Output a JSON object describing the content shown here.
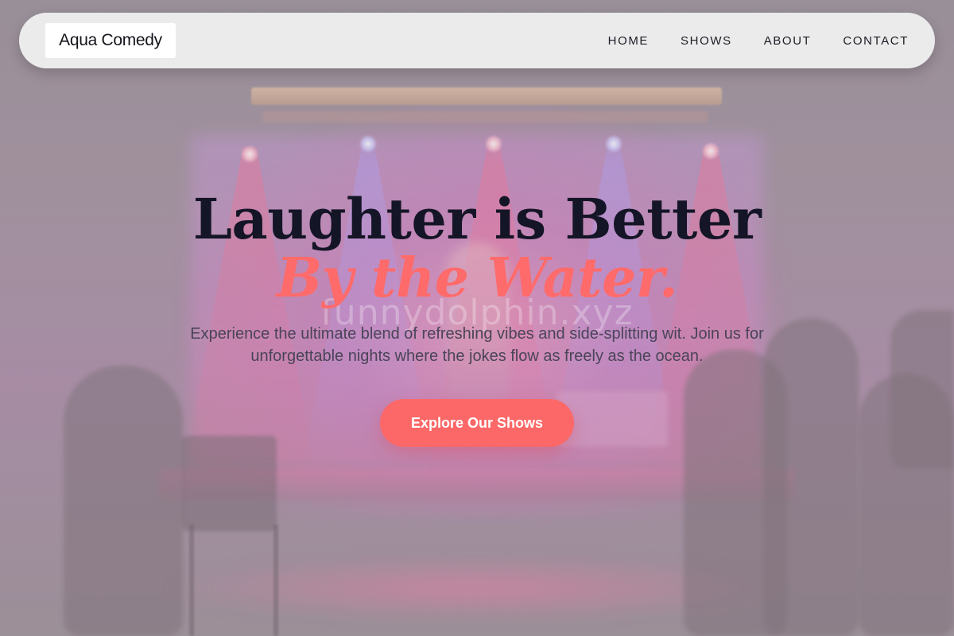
{
  "brand": {
    "logo_text": "Aqua Comedy"
  },
  "nav": {
    "items": [
      {
        "label": "HOME"
      },
      {
        "label": "SHOWS"
      },
      {
        "label": "ABOUT"
      },
      {
        "label": "CONTACT"
      }
    ]
  },
  "hero": {
    "headline": "Laughter is Better",
    "headline_accent": "By the Water.",
    "watermark": "funnydolphin.xyz",
    "subtext": "Experience the ultimate blend of refreshing vibes and side-splitting wit. Join us for unforgettable nights where the jokes flow as freely as the ocean.",
    "cta_label": "Explore Our Shows",
    "background_image": "comedy-stage-photo"
  },
  "colors": {
    "accent": "#fc6868",
    "headline": "#141526",
    "navbar_bg": "#f0f0f0"
  }
}
